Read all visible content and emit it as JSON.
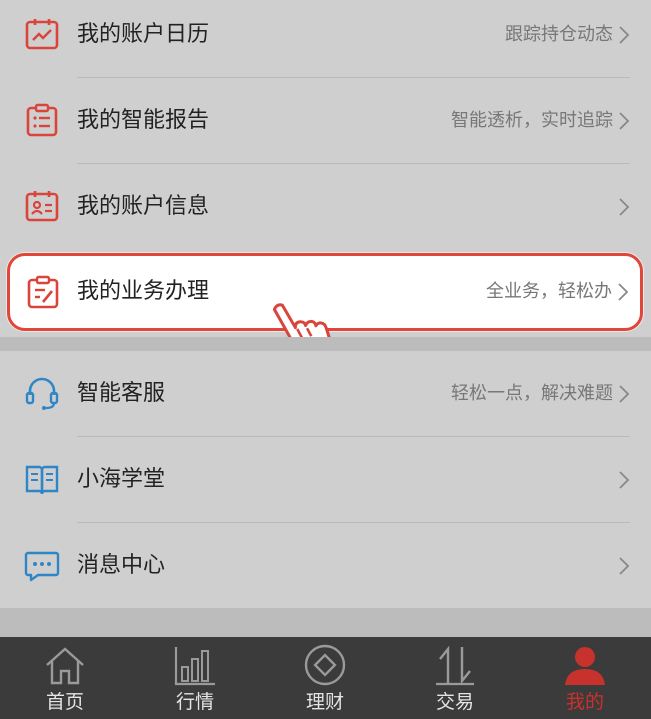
{
  "menu_section_1": [
    {
      "label": "我的账户日历",
      "hint": "跟踪持仓动态"
    },
    {
      "label": "我的智能报告",
      "hint": "智能透析，实时追踪"
    },
    {
      "label": "我的账户信息",
      "hint": ""
    }
  ],
  "highlighted_item": {
    "label": "我的业务办理",
    "hint": "全业务，轻松办"
  },
  "menu_section_2": [
    {
      "label": "智能客服",
      "hint": "轻松一点，解决难题"
    },
    {
      "label": "小海学堂",
      "hint": ""
    },
    {
      "label": "消息中心",
      "hint": ""
    }
  ],
  "tabs": [
    {
      "label": "首页",
      "icon": "home-icon"
    },
    {
      "label": "行情",
      "icon": "bar-chart-icon"
    },
    {
      "label": "理财",
      "icon": "diamond-icon"
    },
    {
      "label": "交易",
      "icon": "exchange-arrows-icon"
    },
    {
      "label": "我的",
      "icon": "user-icon",
      "active": true
    }
  ],
  "colors": {
    "accent_red": "#e0473a",
    "active_tab": "#c8322c",
    "service_blue": "#2f86c6"
  }
}
